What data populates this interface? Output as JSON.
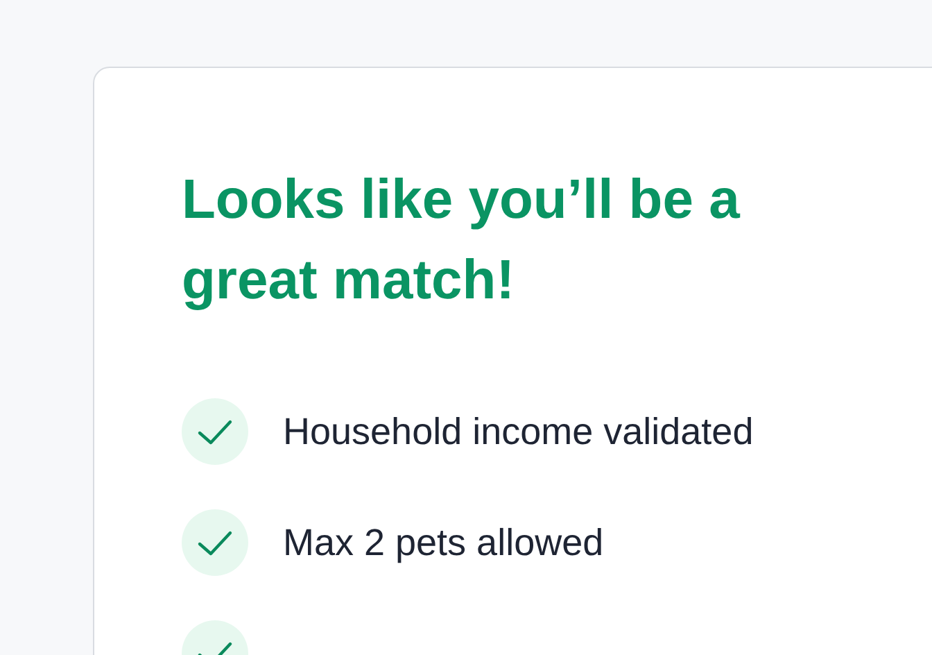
{
  "card": {
    "heading": "Looks like you’ll be a great match!",
    "items": [
      {
        "kind": "check",
        "label": "Household income validated"
      },
      {
        "kind": "check",
        "label": "Max 2 pets allowed"
      },
      {
        "kind": "check"
      }
    ]
  }
}
